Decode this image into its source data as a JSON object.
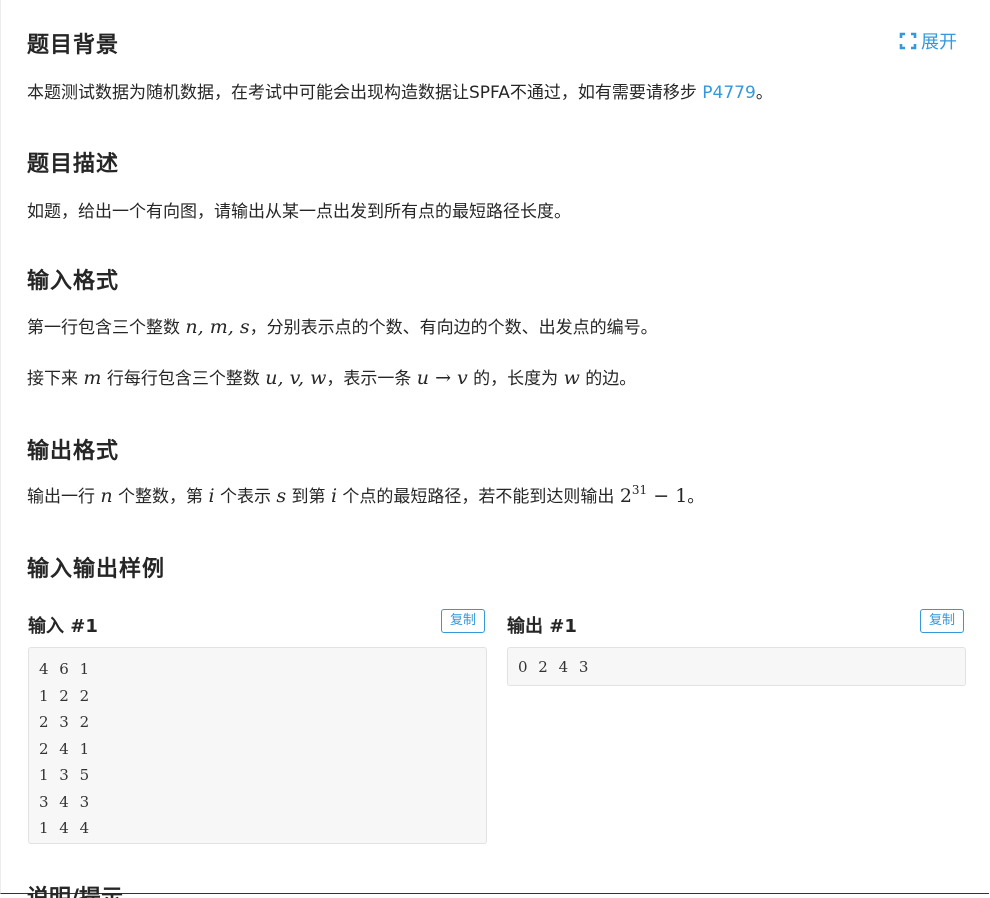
{
  "expand_label": "展开",
  "background": {
    "title": "题目背景",
    "text_before": "本题测试数据为随机数据，在考试中可能会出现构造数据让SPFA不通过，如有需要请移步 ",
    "link": "P4779",
    "text_after": "。"
  },
  "description": {
    "title": "题目描述",
    "text": "如题，给出一个有向图，请输出从某一点出发到所有点的最短路径长度。"
  },
  "input_format": {
    "title": "输入格式",
    "line1": {
      "a": "第一行包含三个整数 ",
      "math": "n, m, s",
      "b": "，分别表示点的个数、有向边的个数、出发点的编号。"
    },
    "line2": {
      "a": "接下来 ",
      "m": "m",
      "b": " 行每行包含三个整数 ",
      "uvw": "u, v, w",
      "c": "，表示一条 ",
      "u": "u",
      "arrow": " → ",
      "v": "v",
      "d": " 的，长度为 ",
      "w": "w",
      "e": " 的边。"
    }
  },
  "output_format": {
    "title": "输出格式",
    "a": "输出一行 ",
    "n": "n",
    "b": " 个整数，第 ",
    "i1": "i",
    "c": " 个表示 ",
    "s": "s",
    "d": " 到第 ",
    "i2": "i",
    "e": " 个点的最短路径，若不能到达则输出 ",
    "base": "2",
    "exp": "31",
    "minus": " − 1",
    "f": "。"
  },
  "samples": {
    "title": "输入输出样例",
    "input_label": "输入 #1",
    "output_label": "输出 #1",
    "copy_label": "复制",
    "input_lines": [
      "4 6 1",
      "1 2 2",
      "2 3 2",
      "2 4 1",
      "1 3 5",
      "3 4 3",
      "1 4 4"
    ],
    "output_lines": [
      "0 2 4 3"
    ]
  },
  "next_section_title": "说明/提示",
  "colors": {
    "accent": "#3498db",
    "text": "#262626",
    "code_bg": "#f7f7f7"
  }
}
